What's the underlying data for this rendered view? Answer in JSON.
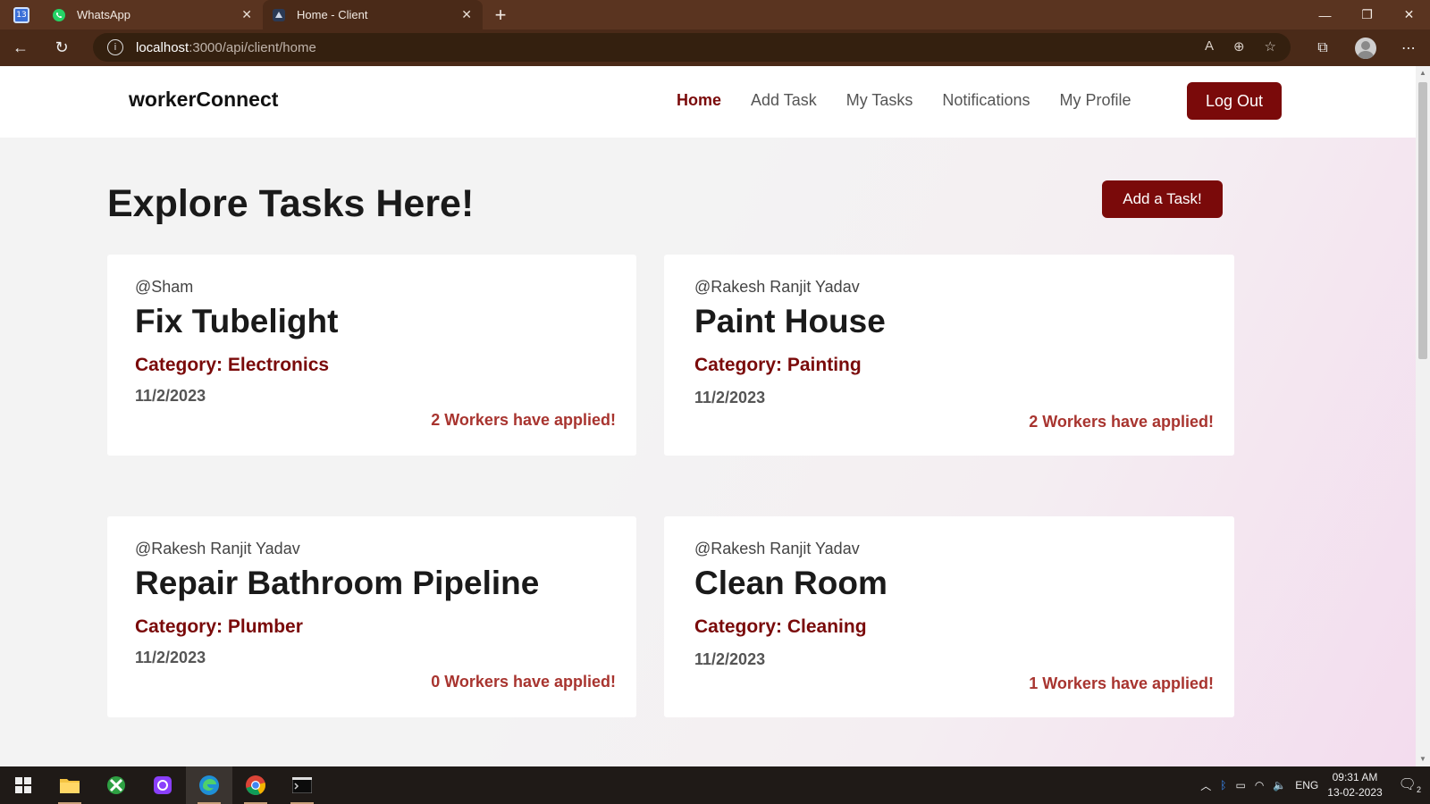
{
  "browser": {
    "tabs": [
      {
        "label": "WhatsApp",
        "active": false,
        "icon": "whatsapp-icon"
      },
      {
        "label": "Home - Client",
        "active": true,
        "icon": "site-favicon"
      }
    ],
    "url_host": "localhost",
    "url_path": ":3000/api/client/home"
  },
  "site": {
    "brand": "workerConnect",
    "nav": [
      {
        "label": "Home",
        "active": true
      },
      {
        "label": "Add Task",
        "active": false
      },
      {
        "label": "My Tasks",
        "active": false
      },
      {
        "label": "Notifications",
        "active": false
      },
      {
        "label": "My Profile",
        "active": false
      }
    ],
    "logout_label": "Log Out"
  },
  "main": {
    "title": "Explore Tasks Here!",
    "add_task_label": "Add a Task!",
    "cards": [
      {
        "author": "@Sham",
        "title": "Fix Tubelight",
        "category": "Category: Electronics",
        "date": "11/2/2023",
        "applied": "2 Workers have applied!"
      },
      {
        "author": "@Rakesh Ranjit Yadav",
        "title": "Paint House",
        "category": "Category: Painting",
        "date": "11/2/2023",
        "applied": "2 Workers have applied!"
      },
      {
        "author": "@Rakesh Ranjit Yadav",
        "title": "Repair Bathroom Pipeline",
        "category": "Category: Plumber",
        "date": "11/2/2023",
        "applied": "0 Workers have applied!"
      },
      {
        "author": "@Rakesh Ranjit Yadav",
        "title": "Clean Room",
        "category": "Category: Cleaning",
        "date": "11/2/2023",
        "applied": "1 Workers have applied!"
      }
    ]
  },
  "taskbar": {
    "language": "ENG",
    "time": "09:31 AM",
    "date": "13-02-2023",
    "notification_count": "2"
  },
  "colors": {
    "accent": "#7a0a0a",
    "applied": "#a8342f",
    "chrome": "#5a3420"
  }
}
